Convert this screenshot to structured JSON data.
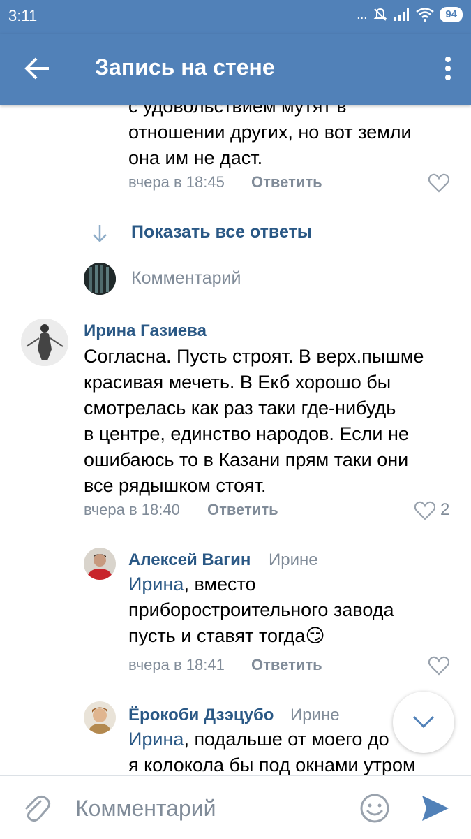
{
  "status_bar": {
    "time": "3:11",
    "signal_dots": "...",
    "battery": "94"
  },
  "app_bar": {
    "title": "Запись на стене"
  },
  "thread": {
    "prev_comment": {
      "lines": [
        "с удовольствием мутят в",
        "отношении других, но вот земли",
        "она им не даст."
      ],
      "date": "вчера в 18:45",
      "reply": "Ответить"
    },
    "show_all_replies": "Показать все ответы",
    "comment_placeholder": "Комментарий"
  },
  "comments": [
    {
      "author": "Ирина Газиева",
      "lines": [
        "Согласна. Пусть строят. В верх.пышме",
        "красивая мечеть. В Екб хорошо бы",
        "смотрелась как раз таки где-нибудь",
        "в центре, единство народов. Если не",
        "ошибаюсь то в Казани прям таки они",
        "все рядышком стоят."
      ],
      "date": "вчера в 18:40",
      "reply": "Ответить",
      "likes": "2"
    },
    {
      "author": "Алексей Вагин",
      "to": "Ирине",
      "mention": "Ирина",
      "first_line_rest": ", вместо",
      "lines": [
        "приборостроительного завода",
        "пусть и ставят тогда"
      ],
      "emoji": "😏",
      "date": "вчера в 18:41",
      "reply": "Ответить"
    },
    {
      "author": "Ёрокоби Дзэцубо",
      "to": "Ирине",
      "mention": "Ирина",
      "first_line_rest": ", подальше от моего до",
      "lines": [
        "я колокола бы под окнами утром"
      ]
    }
  ],
  "bottom_bar": {
    "placeholder": "Комментарий"
  },
  "colors": {
    "brand": "#5181b8",
    "link": "#2a5885",
    "secondary": "#818c99"
  }
}
